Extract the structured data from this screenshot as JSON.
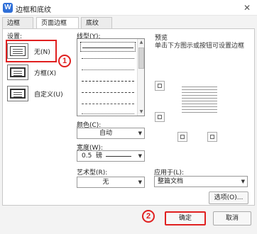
{
  "window": {
    "title": "边框和底纹",
    "close": "✕",
    "app_icon": "W"
  },
  "tabs": [
    {
      "label": "边框(B)",
      "active": false
    },
    {
      "label": "页面边框(P)",
      "active": true
    },
    {
      "label": "底纹(S)",
      "active": false
    }
  ],
  "settings": {
    "heading": "设置:",
    "items": [
      {
        "label": "无(N)",
        "icon": "setting-none-icon",
        "selected": true
      },
      {
        "label": "方框(X)",
        "icon": "setting-box-icon",
        "selected": false
      },
      {
        "label": "自定义(U)",
        "icon": "setting-custom-icon",
        "selected": false
      }
    ]
  },
  "line_style": {
    "heading": "线型(Y):",
    "options": [
      "solid",
      "dotted",
      "dotted-fine",
      "dashed",
      "dash-dot",
      "dash-dot-dot",
      "dotted-sparse"
    ]
  },
  "color": {
    "label": "颜色(C):",
    "value": "自动"
  },
  "width": {
    "label": "宽度(W):",
    "value": "0.5",
    "unit": "磅"
  },
  "art": {
    "label": "艺术型(R):",
    "value": "无"
  },
  "preview": {
    "heading": "预览",
    "hint": "单击下方图示或按钮可设置边框"
  },
  "apply_to": {
    "label": "应用于(L):",
    "value": "整篇文档"
  },
  "buttons": {
    "options": "选项(O)...",
    "ok": "确定",
    "cancel": "取消"
  },
  "annotations": {
    "callout_1": "1",
    "callout_2": "2"
  },
  "colors": {
    "highlight": "#e02020",
    "accent": "#2f6fd8"
  }
}
